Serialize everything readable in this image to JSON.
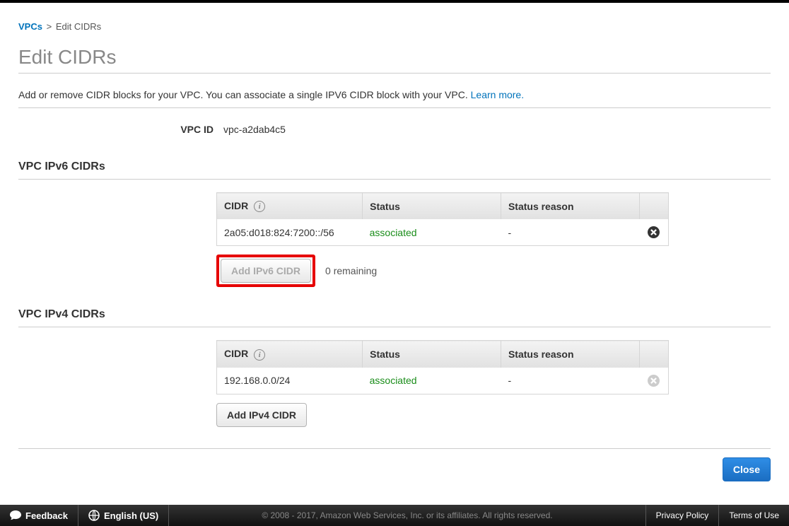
{
  "breadcrumb": {
    "root": "VPCs",
    "current": "Edit CIDRs"
  },
  "page_title": "Edit CIDRs",
  "description": "Add or remove CIDR blocks for your VPC. You can associate a single IPV6 CIDR block with your VPC.",
  "learn_more": "Learn more.",
  "vpc_id": {
    "label": "VPC ID",
    "value": "vpc-a2dab4c5"
  },
  "columns": {
    "cidr": "CIDR",
    "status": "Status",
    "reason": "Status reason"
  },
  "ipv6": {
    "title": "VPC IPv6 CIDRs",
    "rows": [
      {
        "cidr": "2a05:d018:824:7200::/56",
        "status": "associated",
        "reason": "-",
        "removable": true
      }
    ],
    "add_label": "Add IPv6 CIDR",
    "remaining": "0 remaining",
    "add_enabled": false
  },
  "ipv4": {
    "title": "VPC IPv4 CIDRs",
    "rows": [
      {
        "cidr": "192.168.0.0/24",
        "status": "associated",
        "reason": "-",
        "removable": false
      }
    ],
    "add_label": "Add IPv4 CIDR",
    "add_enabled": true
  },
  "close_label": "Close",
  "footer": {
    "feedback": "Feedback",
    "language": "English (US)",
    "copyright": "© 2008 - 2017, Amazon Web Services, Inc. or its affiliates. All rights reserved.",
    "privacy": "Privacy Policy",
    "terms": "Terms of Use"
  }
}
